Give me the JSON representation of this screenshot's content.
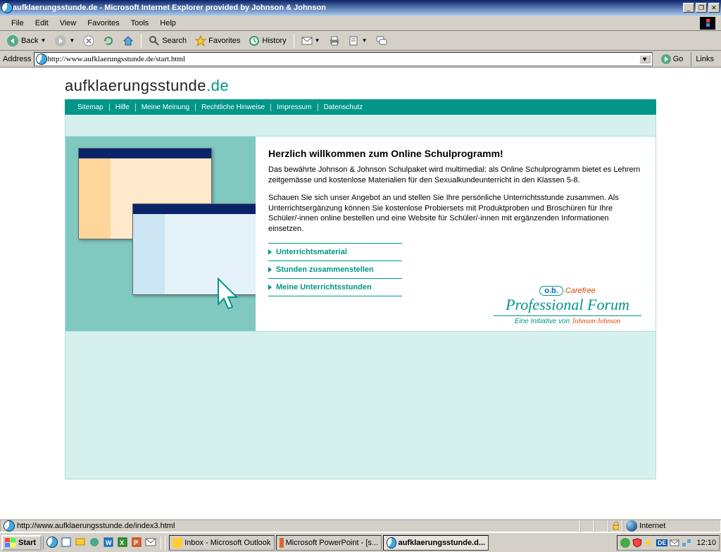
{
  "window": {
    "title": "aufklaerungsstunde.de - Microsoft Internet Explorer provided by Johnson & Johnson"
  },
  "menu": {
    "file": "File",
    "edit": "Edit",
    "view": "View",
    "favorites": "Favorites",
    "tools": "Tools",
    "help": "Help"
  },
  "toolbar": {
    "back": "Back",
    "search": "Search",
    "favorites": "Favorites",
    "history": "History"
  },
  "address": {
    "label": "Address",
    "url": "http://www.aufklaerungsstunde.de/start.html",
    "go": "Go",
    "links": "Links"
  },
  "page": {
    "logo_main": "aufklaerungsstunde",
    "logo_tld": ".de",
    "nav": [
      "Sitemap",
      "Hilfe",
      "Meine Meinung",
      "Rechtliche Hinweise",
      "Impressum",
      "Datenschutz"
    ],
    "heading": "Herzlich willkommen zum Online Schulprogramm!",
    "para1": "Das bewährte Johnson & Johnson Schulpaket wird multimedial: als Online Schulprogramm bietet es Lehrern zeitgemässe und kostenlose Materialien für den Sexualkundeunterricht in den Klassen 5-8.",
    "para2": "Schauen Sie sich unser Angebot an und stellen Sie Ihre persönliche Unterrichtsstunde zusammen. Als Unterrichtsergänzung können Sie kostenlose Probiersets mit Produktproben und Broschüren für Ihre Schüler/-innen online bestellen und eine Website für Schüler/-innen mit ergänzenden Informationen einsetzen.",
    "actions": [
      "Unterrichtsmaterial",
      "Stunden zusammenstellen",
      "Meine Unterrichtsstunden"
    ],
    "brand_ob": "o.b.",
    "brand_cf": "Carefree",
    "brand_forum": "Professional Forum",
    "brand_init": "Eine Initiative von ",
    "brand_jj": "Johnson·Johnson"
  },
  "status": {
    "text": "http://www.aufklaerungsstunde.de/index3.html",
    "zone": "Internet"
  },
  "taskbar": {
    "start": "Start",
    "tasks": [
      {
        "label": "Inbox - Microsoft Outlook",
        "active": false
      },
      {
        "label": "Microsoft PowerPoint - [s...",
        "active": false
      },
      {
        "label": "aufklaerungsstunde.d...",
        "active": true
      }
    ],
    "clock": "12:10"
  }
}
